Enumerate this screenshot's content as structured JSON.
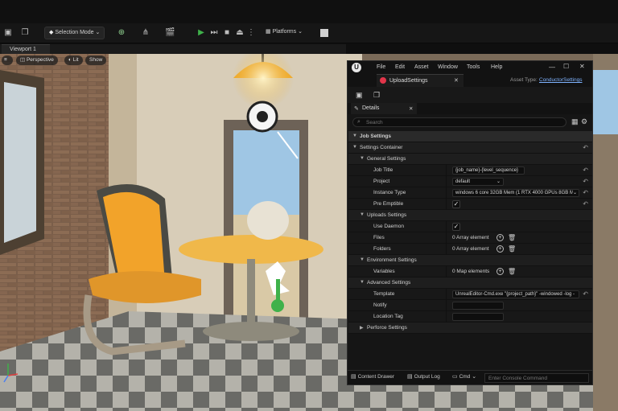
{
  "toolbar": {
    "selection_mode": "Selection Mode",
    "platforms": "Platforms"
  },
  "viewport": {
    "tab": "Viewport 1",
    "perspective": "Perspective",
    "lit": "Lit",
    "show": "Show"
  },
  "window": {
    "menu": [
      "File",
      "Edit",
      "Asset",
      "Window",
      "Tools",
      "Help"
    ],
    "tab_title": "UploadSettings",
    "asset_type_label": "Asset Type:",
    "asset_type_value": "ConductorSettings",
    "details_tab": "Details",
    "search_placeholder": "Search",
    "sections": {
      "job_settings": "Job Settings",
      "settings_container": "Settings Container",
      "general_settings": "General Settings",
      "uploads_settings": "Uploads Settings",
      "environment_settings": "Environment Settings",
      "advanced_settings": "Advanced Settings",
      "perforce_settings": "Perforce Settings"
    },
    "props": {
      "job_title": {
        "label": "Job Title",
        "value": "{job_name}-{level_sequence}"
      },
      "project": {
        "label": "Project",
        "value": "default"
      },
      "instance_type": {
        "label": "Instance Type",
        "value": "windows 6 core 32GB Mem (1 RTX 4000 GPUs 8GB Me"
      },
      "pre_emptible": {
        "label": "Pre Emptible"
      },
      "use_daemon": {
        "label": "Use Daemon"
      },
      "files": {
        "label": "Files",
        "value": "0 Array element"
      },
      "folders": {
        "label": "Folders",
        "value": "0 Array element"
      },
      "variables": {
        "label": "Variables",
        "value": "0 Map elements"
      },
      "template": {
        "label": "Template",
        "value": "UnrealEditor-Cmd.exe \"{project_path}\" -windowed -log -"
      },
      "notify": {
        "label": "Notify",
        "value": ""
      },
      "location_tag": {
        "label": "Location Tag",
        "value": ""
      }
    },
    "bottom": {
      "content_drawer": "Content Drawer",
      "output_log": "Output Log",
      "cmd": "Cmd",
      "console_placeholder": "Enter Console Command"
    }
  },
  "colors": {
    "accent_green": "#3fb14a",
    "panel_bg": "#151515",
    "link_blue": "#7fb3ff"
  }
}
